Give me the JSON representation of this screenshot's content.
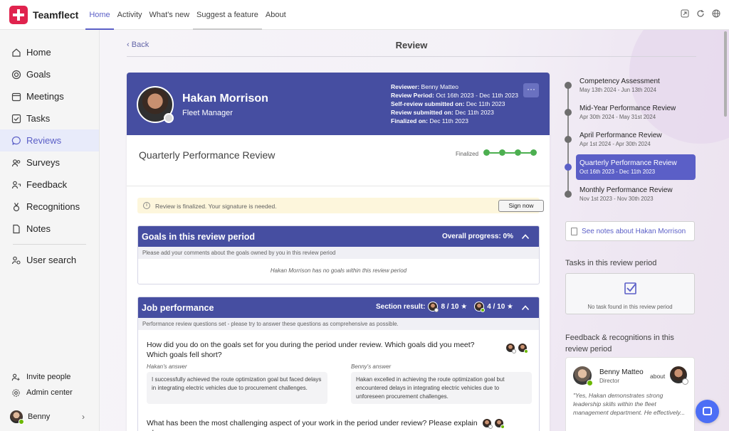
{
  "app": {
    "brand": "Teamflect",
    "brand_color": "#e0234e",
    "accent": "#5b5fc7"
  },
  "topnav": {
    "tabs": [
      {
        "label": "Home",
        "active": true
      },
      {
        "label": "Activity"
      },
      {
        "label": "What's new"
      },
      {
        "label": "Suggest a feature"
      },
      {
        "label": "About"
      }
    ],
    "icons": [
      "popout-icon",
      "refresh-icon",
      "globe-icon"
    ]
  },
  "sidebar": {
    "items": [
      {
        "label": "Home",
        "icon": "home-icon"
      },
      {
        "label": "Goals",
        "icon": "target-icon"
      },
      {
        "label": "Meetings",
        "icon": "calendar-icon"
      },
      {
        "label": "Tasks",
        "icon": "checkbox-icon"
      },
      {
        "label": "Reviews",
        "icon": "chat-bubble-icon",
        "active": true
      },
      {
        "label": "Surveys",
        "icon": "people-icon"
      },
      {
        "label": "Feedback",
        "icon": "person-feedback-icon"
      },
      {
        "label": "Recognitions",
        "icon": "medal-icon"
      },
      {
        "label": "Notes",
        "icon": "document-icon"
      }
    ],
    "search": {
      "label": "User search",
      "icon": "person-search-icon"
    },
    "bottom": {
      "invite": "Invite people",
      "admin": "Admin center",
      "user": "Benny"
    }
  },
  "header": {
    "back": "Back",
    "title": "Review"
  },
  "profile": {
    "name": "Hakan Morrison",
    "role": "Fleet Manager",
    "meta": {
      "reviewer_label": "Reviewer:",
      "reviewer": "Benny Matteo",
      "period_label": "Review Period:",
      "period": "Oct 16th 2023 - Dec 11th 2023",
      "self_label": "Self-review submitted on:",
      "self": "Dec 11th 2023",
      "review_label": "Review submitted on:",
      "review": "Dec 11th 2023",
      "finalized_label": "Finalized on:",
      "finalized": "Dec 11th 2023"
    },
    "more": "···"
  },
  "review": {
    "title": "Quarterly Performance Review",
    "status": "Finalized",
    "steps_complete": 4
  },
  "banner": {
    "icon": "info-icon",
    "text": "Review is finalized. Your signature is needed.",
    "button": "Sign now"
  },
  "goals": {
    "title": "Goals in this review period",
    "progress": "Overall progress: 0%",
    "sub": "Please add your comments about the goals owned by you in this review period",
    "empty": "Hakan Morrison has no goals within this review period"
  },
  "job": {
    "title": "Job performance",
    "result_label": "Section result:",
    "score1": "8 / 10 ★",
    "score2": "4 / 10 ★",
    "sub": "Performance review questions set - please try to answer these questions as comprehensive as possible.",
    "q1": "How did you do on the goals set for you during the period under review. Which goals did you meet? Which goals fell short?",
    "a1_label": "Hakan's answer",
    "a1": "I successfully achieved the route optimization goal but faced delays in integrating electric vehicles due to procurement challenges.",
    "b1_label": "Benny's answer",
    "b1": "Hakan excelled in achieving the route optimization goal but encountered delays in integrating electric vehicles due to unforeseen procurement challenges.",
    "q2": "What has been the most challenging aspect of your work in the period under review? Please explain why."
  },
  "timeline": [
    {
      "name": "Competency Assessment",
      "date": "May 13th 2024 - Jun 13th 2024"
    },
    {
      "name": "Mid-Year Performance Review",
      "date": "Apr 30th 2024 - May 31st 2024"
    },
    {
      "name": "April Performance Review",
      "date": "Apr 1st 2024 - Apr 30th 2024"
    },
    {
      "name": "Quarterly Performance Review",
      "date": "Oct 16th 2023 - Dec 11th 2023",
      "active": true
    },
    {
      "name": "Monthly Performance Review",
      "date": "Nov 1st 2023 - Nov 30th 2023"
    }
  ],
  "right": {
    "notes": "See notes about Hakan Morrison",
    "tasks_title": "Tasks in this review period",
    "tasks_empty": "No task found in this review period",
    "feedback_title": "Feedback & recognitions in this review period",
    "feedback": {
      "name": "Benny Matteo",
      "role": "Director",
      "about": "about",
      "quote": "\"Yes, Hakan demonstrates strong leadership skills within the fleet management department. He effectively..."
    }
  }
}
